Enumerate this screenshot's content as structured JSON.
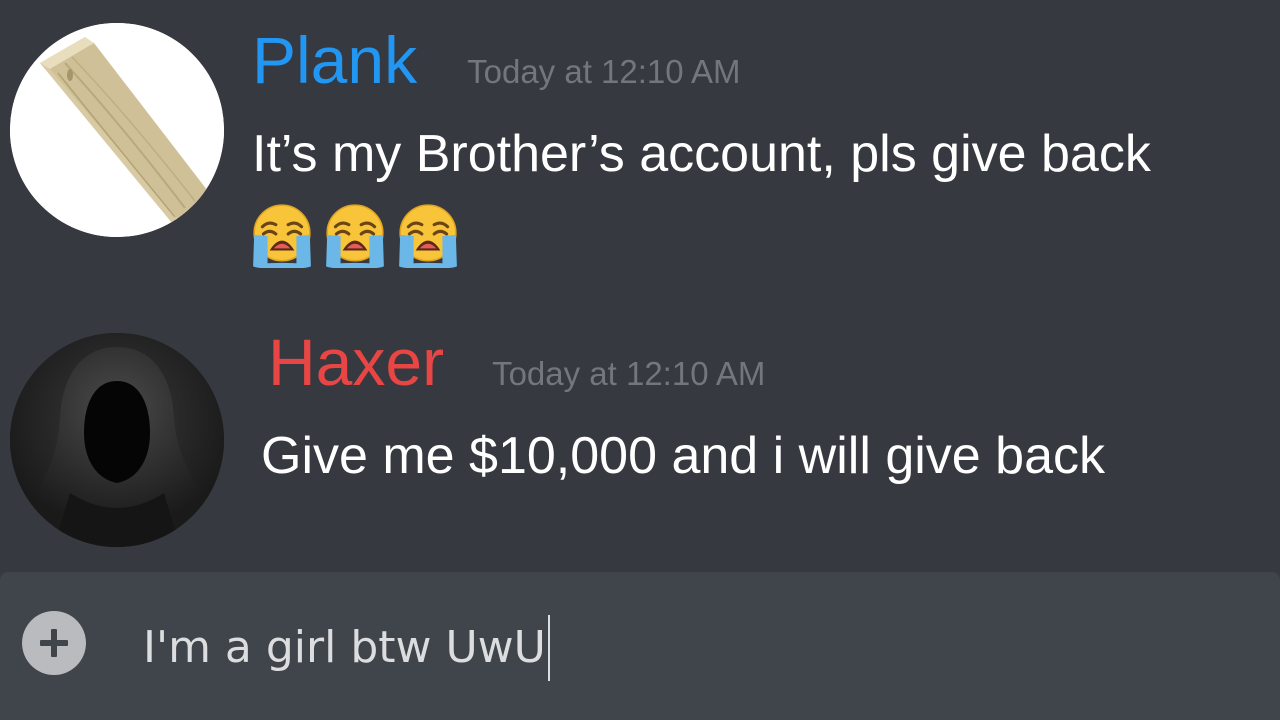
{
  "messages": [
    {
      "username": "Plank",
      "username_color": "#2196f3",
      "timestamp": "Today at 12:10 AM",
      "text": "It’s my Brother’s account, pls give back",
      "emojis": [
        "loudly-crying-face",
        "loudly-crying-face",
        "loudly-crying-face"
      ],
      "avatar": "wooden-plank"
    },
    {
      "username": "Haxer",
      "username_color": "#e84545",
      "timestamp": "Today at 12:10 AM",
      "text": "Give me $10,000 and i will give back",
      "avatar": "hooded-figure"
    }
  ],
  "composer": {
    "value": "I'm a girl btw UwU",
    "attach_icon": "plus-icon"
  }
}
